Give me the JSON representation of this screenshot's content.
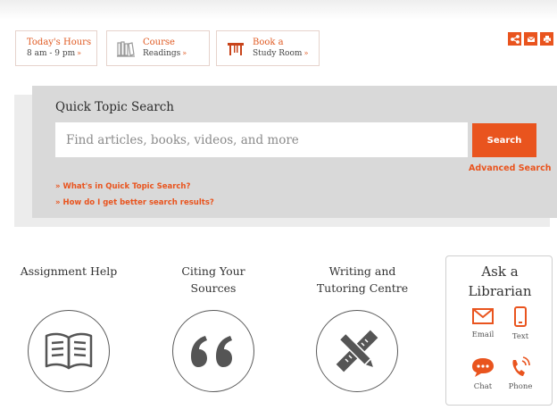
{
  "quick_links": [
    {
      "title": "Today's Hours",
      "subtitle": "8 am - 9 pm",
      "arrow": "»"
    },
    {
      "title": "Course",
      "subtitle": "Readings",
      "arrow": "»"
    },
    {
      "title": "Book a",
      "subtitle": "Study Room",
      "arrow": "»"
    }
  ],
  "share": {
    "icons": [
      "share-icon",
      "email-icon",
      "print-icon"
    ],
    "color": "#e9541e"
  },
  "search": {
    "title": "Quick Topic Search",
    "placeholder": "Find articles, books, videos, and more",
    "button_label": "Search",
    "advanced_link": "Advanced Search",
    "help_links": [
      "» What's in Quick Topic Search?",
      "» How do I get better search results?"
    ]
  },
  "services": [
    {
      "line1": "Assignment Help",
      "line2": "",
      "icon": "book-icon"
    },
    {
      "line1": "Citing Your",
      "line2": "Sources",
      "icon": "quote-icon"
    },
    {
      "line1": "Writing and",
      "line2": "Tutoring Centre",
      "icon": "pencil-ruler-icon"
    }
  ],
  "ask": {
    "title_line1": "Ask a",
    "title_line2": "Librarian",
    "contacts": [
      {
        "label": "Email",
        "icon": "email-icon"
      },
      {
        "label": "Text",
        "icon": "phone-text-icon"
      },
      {
        "label": "Chat",
        "icon": "chat-icon"
      },
      {
        "label": "Phone",
        "icon": "phone-icon"
      }
    ]
  },
  "colors": {
    "accent": "#e9541e",
    "panel": "#d9d9d9",
    "text": "#333333"
  }
}
